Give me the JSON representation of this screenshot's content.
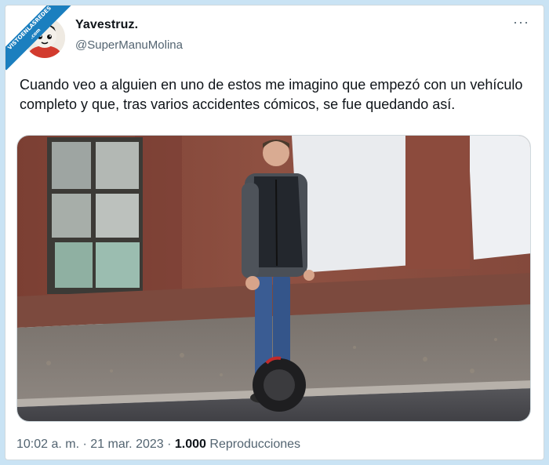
{
  "watermark": {
    "line1": "VISTOENLASREDES",
    "line2": ".com"
  },
  "author": {
    "name": "Yavestruz.",
    "handle": "@SuperManuMolina"
  },
  "menu": {
    "more_label": "···"
  },
  "tweet": {
    "text": "Cuando veo a alguien en uno de estos me imagino que empezó con un vehículo completo y que, tras varios accidentes cómicos, se fue quedando así."
  },
  "media": {
    "description": "Hombre sobre un monociclo eléctrico frente a un edificio de ladrillo",
    "colors": {
      "brick": "#8a4a3c",
      "pavement": "#6f6a66",
      "road": "#4b4b4f",
      "jeans": "#3a5c93",
      "vest": "#262a30"
    }
  },
  "meta": {
    "time": "10:02 a. m.",
    "sep1": " · ",
    "date": "21 mar. 2023",
    "sep2": " · ",
    "views_count": "1.000",
    "views_label": " Reproducciones"
  }
}
